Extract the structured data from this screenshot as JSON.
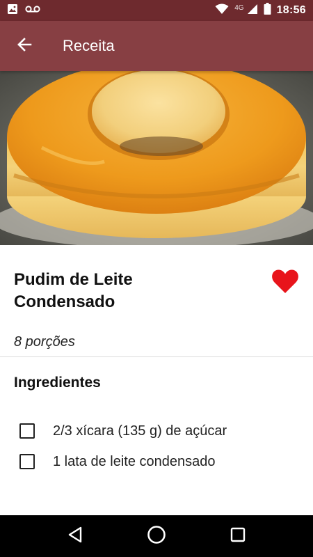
{
  "status_bar": {
    "time": "18:56",
    "network": "4G",
    "icons": [
      "image-icon",
      "voicemail-icon",
      "wifi-icon",
      "signal-icon",
      "battery-icon"
    ]
  },
  "app_bar": {
    "title": "Receita",
    "back_icon": "arrow-back-icon",
    "background": "#873f43"
  },
  "hero": {
    "image_subject": "pudim de leite condensado"
  },
  "recipe": {
    "title": "Pudim de Leite Condensado",
    "portions": "8 porções",
    "favorite": true,
    "favorite_color": "#e8141b"
  },
  "ingredients_section": {
    "title": "Ingredientes",
    "items": [
      {
        "label": "2/3 xícara (135 g) de açúcar",
        "checked": false
      },
      {
        "label": "1 lata de leite condensado",
        "checked": false
      }
    ]
  },
  "nav_bar": {
    "buttons": [
      "back-triangle-icon",
      "home-circle-icon",
      "recents-square-icon"
    ]
  }
}
